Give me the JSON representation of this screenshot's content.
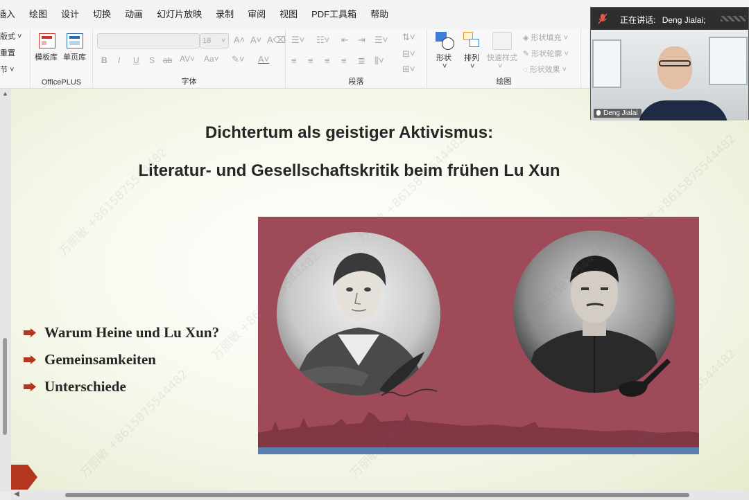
{
  "menu": {
    "items": [
      "插入",
      "绘图",
      "设计",
      "切换",
      "动画",
      "幻灯片放映",
      "录制",
      "审阅",
      "视图",
      "PDF工具箱",
      "帮助"
    ]
  },
  "ribbon": {
    "slides_group": {
      "layout": "版式",
      "reset": "重置",
      "section": "节"
    },
    "officeplus": {
      "template_lib": "模板库",
      "single_page_lib": "单页库",
      "label": "OfficePLUS"
    },
    "font": {
      "font_size": "18",
      "bold": "B",
      "italic": "I",
      "underline": "U",
      "shadow": "S",
      "strike": "ab",
      "label": "字体"
    },
    "paragraph": {
      "label": "段落"
    },
    "drawing": {
      "shapes": "形状",
      "arrange": "排列",
      "quick_styles": "快速样式",
      "shape_fill": "形状填充",
      "shape_outline": "形状轮廓",
      "shape_effects": "形状效果",
      "label": "绘图"
    }
  },
  "video": {
    "speaking_label": "正在讲话:",
    "speaker": "Deng Jialai;",
    "participant_name": "Deng Jialai"
  },
  "slide": {
    "title_line1": "Dichtertum als geistiger Aktivismus:",
    "title_line2": "Literatur- und Gesellschaftskritik beim frühen Lu Xun",
    "bullets": [
      "Warum Heine und Lu Xun?",
      "Gemeinsamkeiten",
      "Unterschiede"
    ],
    "panel_color": "#9e4a58",
    "accent_color": "#b5361f"
  },
  "watermark": {
    "text": "万丽敏 +8615875544482"
  }
}
